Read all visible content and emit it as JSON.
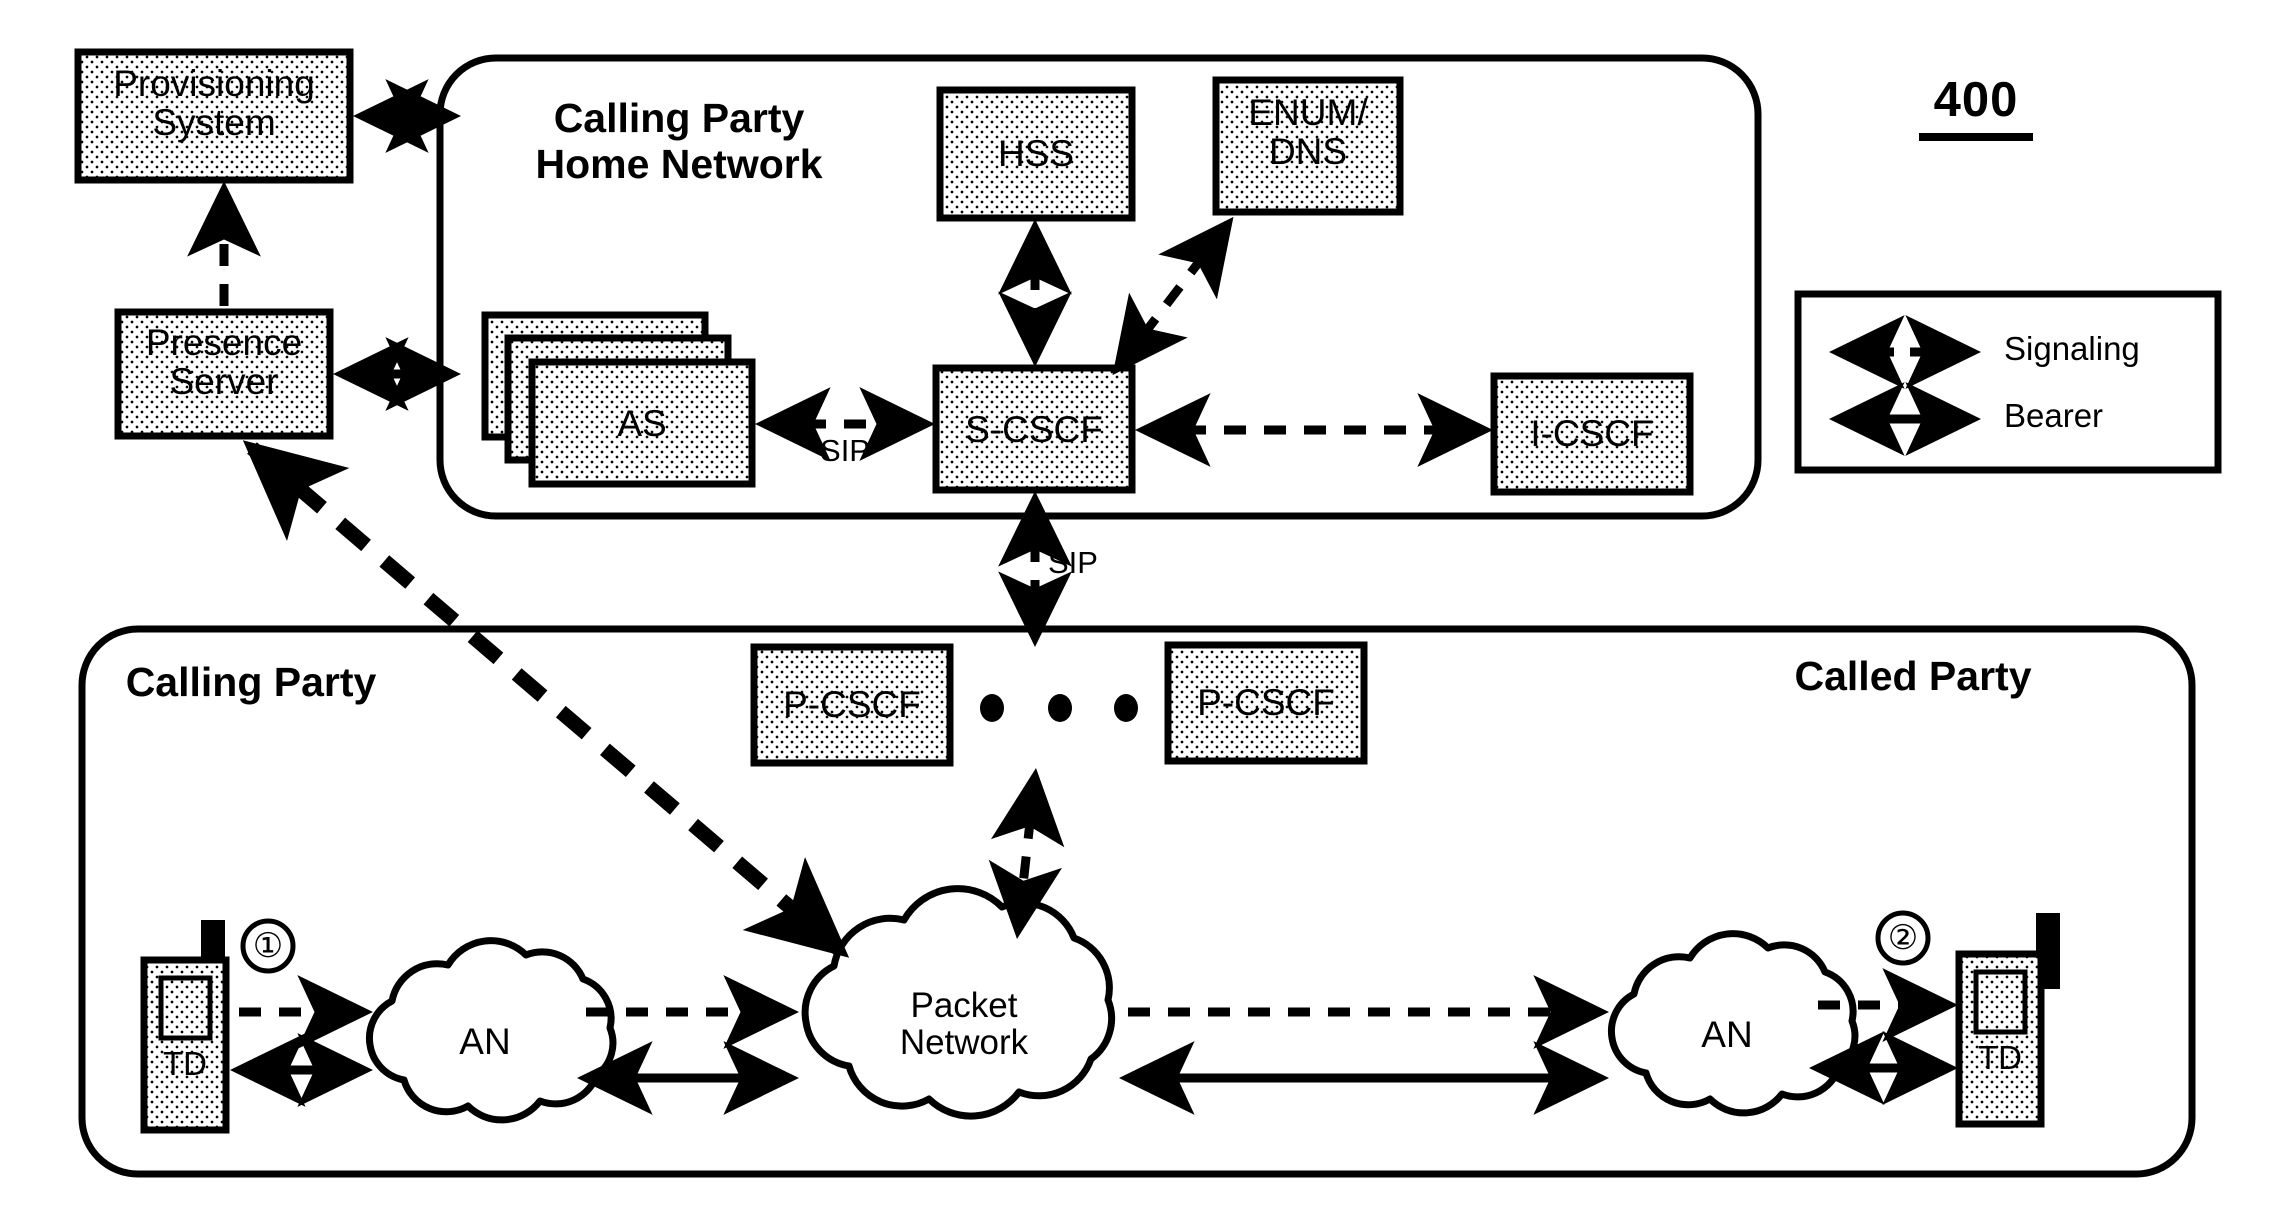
{
  "figure": {
    "number": "400",
    "underlined": true
  },
  "zones": [
    {
      "id": "home-network",
      "title": "Calling Party\nHome Network",
      "shape": "rounded-rect"
    },
    {
      "id": "access-zone",
      "left_title": "Calling Party",
      "right_title": "Called Party",
      "shape": "rounded-rect"
    }
  ],
  "nodes": {
    "provisioning_system": {
      "label": "Provisioning\nSystem",
      "fill": "stipple"
    },
    "presence_server": {
      "label": "Presence\nServer",
      "fill": "stipple"
    },
    "hss": {
      "label": "HSS",
      "fill": "stipple"
    },
    "enum_dns": {
      "label": "ENUM/\nDNS",
      "fill": "stipple"
    },
    "as": {
      "label": "AS",
      "fill": "stipple",
      "stacked": 3
    },
    "s_cscf": {
      "label": "S-CSCF",
      "fill": "stipple"
    },
    "i_cscf": {
      "label": "I-CSCF",
      "fill": "stipple"
    },
    "p_cscf_left": {
      "label": "P-CSCF",
      "fill": "stipple"
    },
    "p_cscf_right": {
      "label": "P-CSCF",
      "fill": "stipple"
    },
    "ellipsis_between_pcscf": {
      "label": "●  ●  ●",
      "dots": 3
    },
    "td_left": {
      "label": "TD",
      "fill": "stipple",
      "icon": "mobile-handset"
    },
    "td_right": {
      "label": "TD",
      "fill": "stipple",
      "icon": "mobile-handset"
    },
    "an_left": {
      "label": "AN",
      "shape": "cloud"
    },
    "an_right": {
      "label": "AN",
      "shape": "cloud"
    },
    "packet_network": {
      "label": "Packet\nNetwork",
      "shape": "cloud"
    }
  },
  "wire_labels": {
    "sip_as_scscf": "SIP",
    "sip_scscf_pcscf": "SIP"
  },
  "step_markers": {
    "calling_side": "①",
    "called_side": "②"
  },
  "legend": {
    "items": [
      {
        "style": "dashed-double-arrow",
        "label": "Signaling"
      },
      {
        "style": "solid-double-arrow",
        "label": "Bearer"
      }
    ]
  },
  "colors": {
    "stroke": "#000000",
    "background": "#ffffff",
    "stipple_fill": "#e8e8e8"
  }
}
